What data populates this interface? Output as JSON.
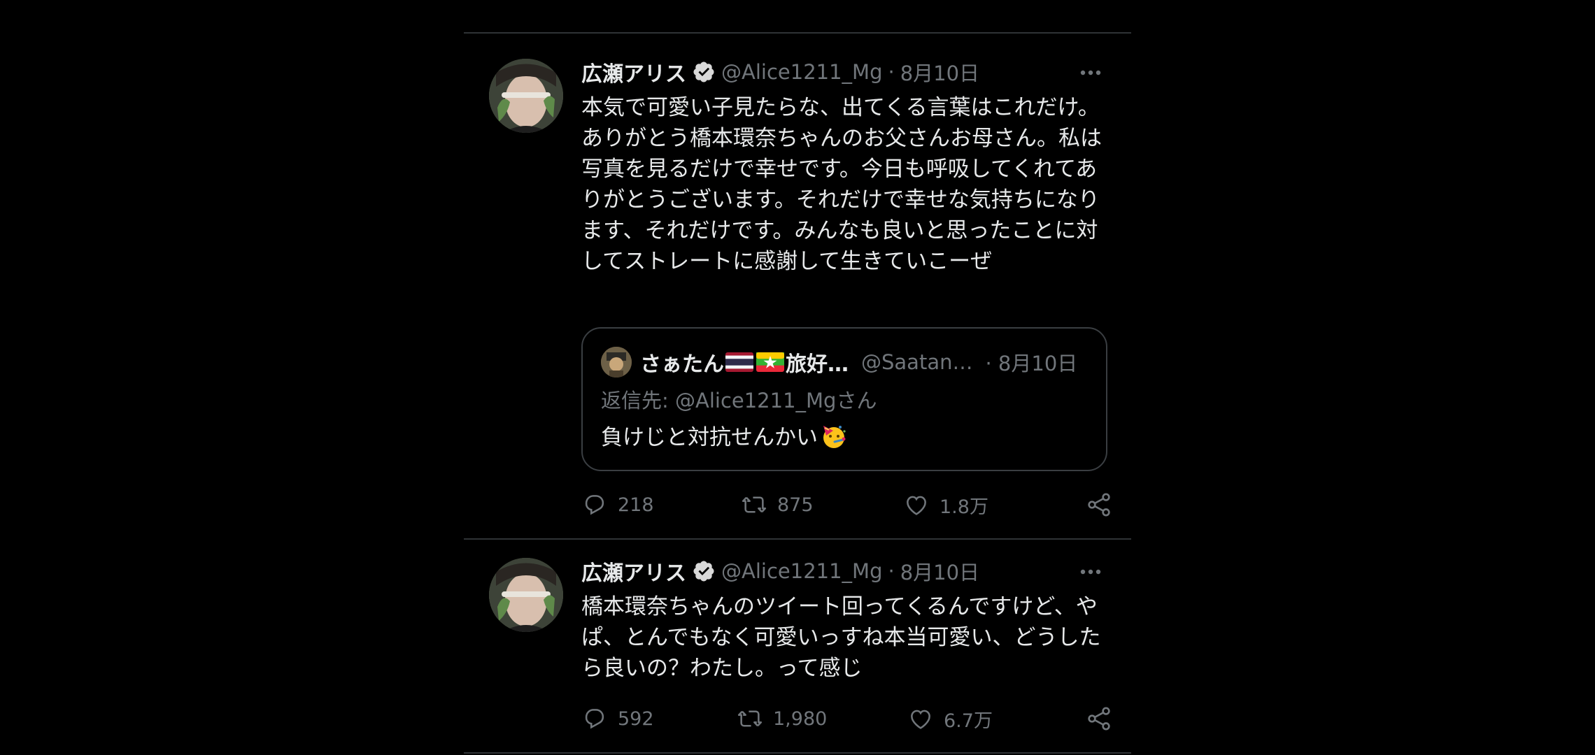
{
  "tweets": [
    {
      "author_name": "広瀬アリス",
      "handle": "@Alice1211_Mg",
      "separator": "·",
      "date": "8月10日",
      "text": "本気で可愛い子見たらな、出てくる言葉はこれだけ。\nありがとう橋本環奈ちゃんのお父さんお母さん。私は写真を見るだけで幸せです。今日も呼吸してくれてありがとうございます。それだけで幸せな気持ちになります、それだけです。みんなも良いと思ったことに対してストレートに感謝して生きていこーぜ",
      "quote": {
        "author_name_prefix": "さぁたん",
        "author_name_suffix": "旅好…",
        "handle": "@Saatan…",
        "date": "· 8月10日",
        "reply_to": "返信先: @Alice1211_Mgさん",
        "text": "負けじと対抗せんかい"
      },
      "replies": "218",
      "retweets": "875",
      "likes": "1.8万"
    },
    {
      "author_name": "広瀬アリス",
      "handle": "@Alice1211_Mg",
      "separator": "·",
      "date": "8月10日",
      "text": "橋本環奈ちゃんのツイート回ってくるんですけど、やぱ、とんでもなく可愛いっすね本当可愛い、どうしたら良いの？わたし。って感じ",
      "replies": "592",
      "retweets": "1,980",
      "likes": "6.7万"
    }
  ],
  "colors": {
    "background": "#000000",
    "text_primary": "#e7e9ea",
    "text_secondary": "#71767b",
    "divider": "#2f3336"
  }
}
